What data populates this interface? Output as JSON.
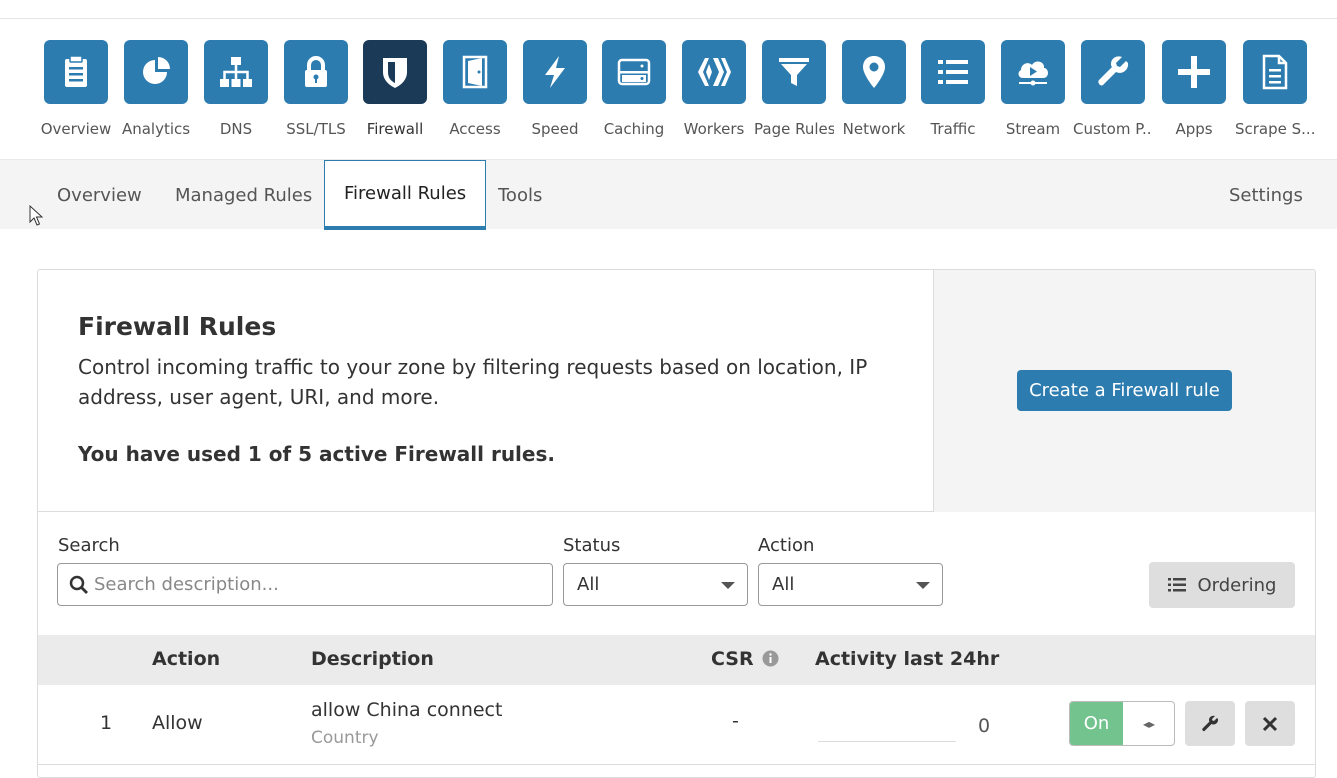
{
  "colors": {
    "accent": "#2c7cb0",
    "active_tile": "#1b3a57",
    "toggle_on": "#72c38e"
  },
  "apps": [
    {
      "label": "Overview",
      "icon": "clipboard-icon"
    },
    {
      "label": "Analytics",
      "icon": "pie-chart-icon"
    },
    {
      "label": "DNS",
      "icon": "network-tree-icon"
    },
    {
      "label": "SSL/TLS",
      "icon": "lock-icon"
    },
    {
      "label": "Firewall",
      "icon": "shield-icon"
    },
    {
      "label": "Access",
      "icon": "door-icon"
    },
    {
      "label": "Speed",
      "icon": "lightning-icon"
    },
    {
      "label": "Caching",
      "icon": "server-icon"
    },
    {
      "label": "Workers",
      "icon": "workers-icon"
    },
    {
      "label": "Page Rules",
      "icon": "filter-icon"
    },
    {
      "label": "Network",
      "icon": "map-pin-icon"
    },
    {
      "label": "Traffic",
      "icon": "list-icon"
    },
    {
      "label": "Stream",
      "icon": "cloud-icon"
    },
    {
      "label": "Custom P...",
      "icon": "wrench-icon"
    },
    {
      "label": "Apps",
      "icon": "plus-icon"
    },
    {
      "label": "Scrape S...",
      "icon": "document-icon"
    }
  ],
  "subtabs": {
    "overview": "Overview",
    "managed_rules": "Managed Rules",
    "firewall_rules": "Firewall Rules",
    "tools": "Tools",
    "settings": "Settings"
  },
  "card": {
    "title": "Firewall Rules",
    "description": "Control incoming traffic to your zone by filtering requests based on location, IP address, user agent, URI, and more.",
    "usage": "You have used 1 of 5 active Firewall rules.",
    "create_button": "Create a Firewall rule"
  },
  "filters": {
    "search_label": "Search",
    "search_placeholder": "Search description...",
    "status_label": "Status",
    "status_value": "All",
    "action_label": "Action",
    "action_value": "All",
    "ordering_button": "Ordering"
  },
  "table": {
    "headers": {
      "action": "Action",
      "description": "Description",
      "csr": "CSR",
      "activity": "Activity last 24hr"
    },
    "rows": [
      {
        "index": "1",
        "action": "Allow",
        "description": "allow China connect",
        "field": "Country",
        "csr": "-",
        "activity": "0",
        "toggle": "On"
      }
    ]
  }
}
